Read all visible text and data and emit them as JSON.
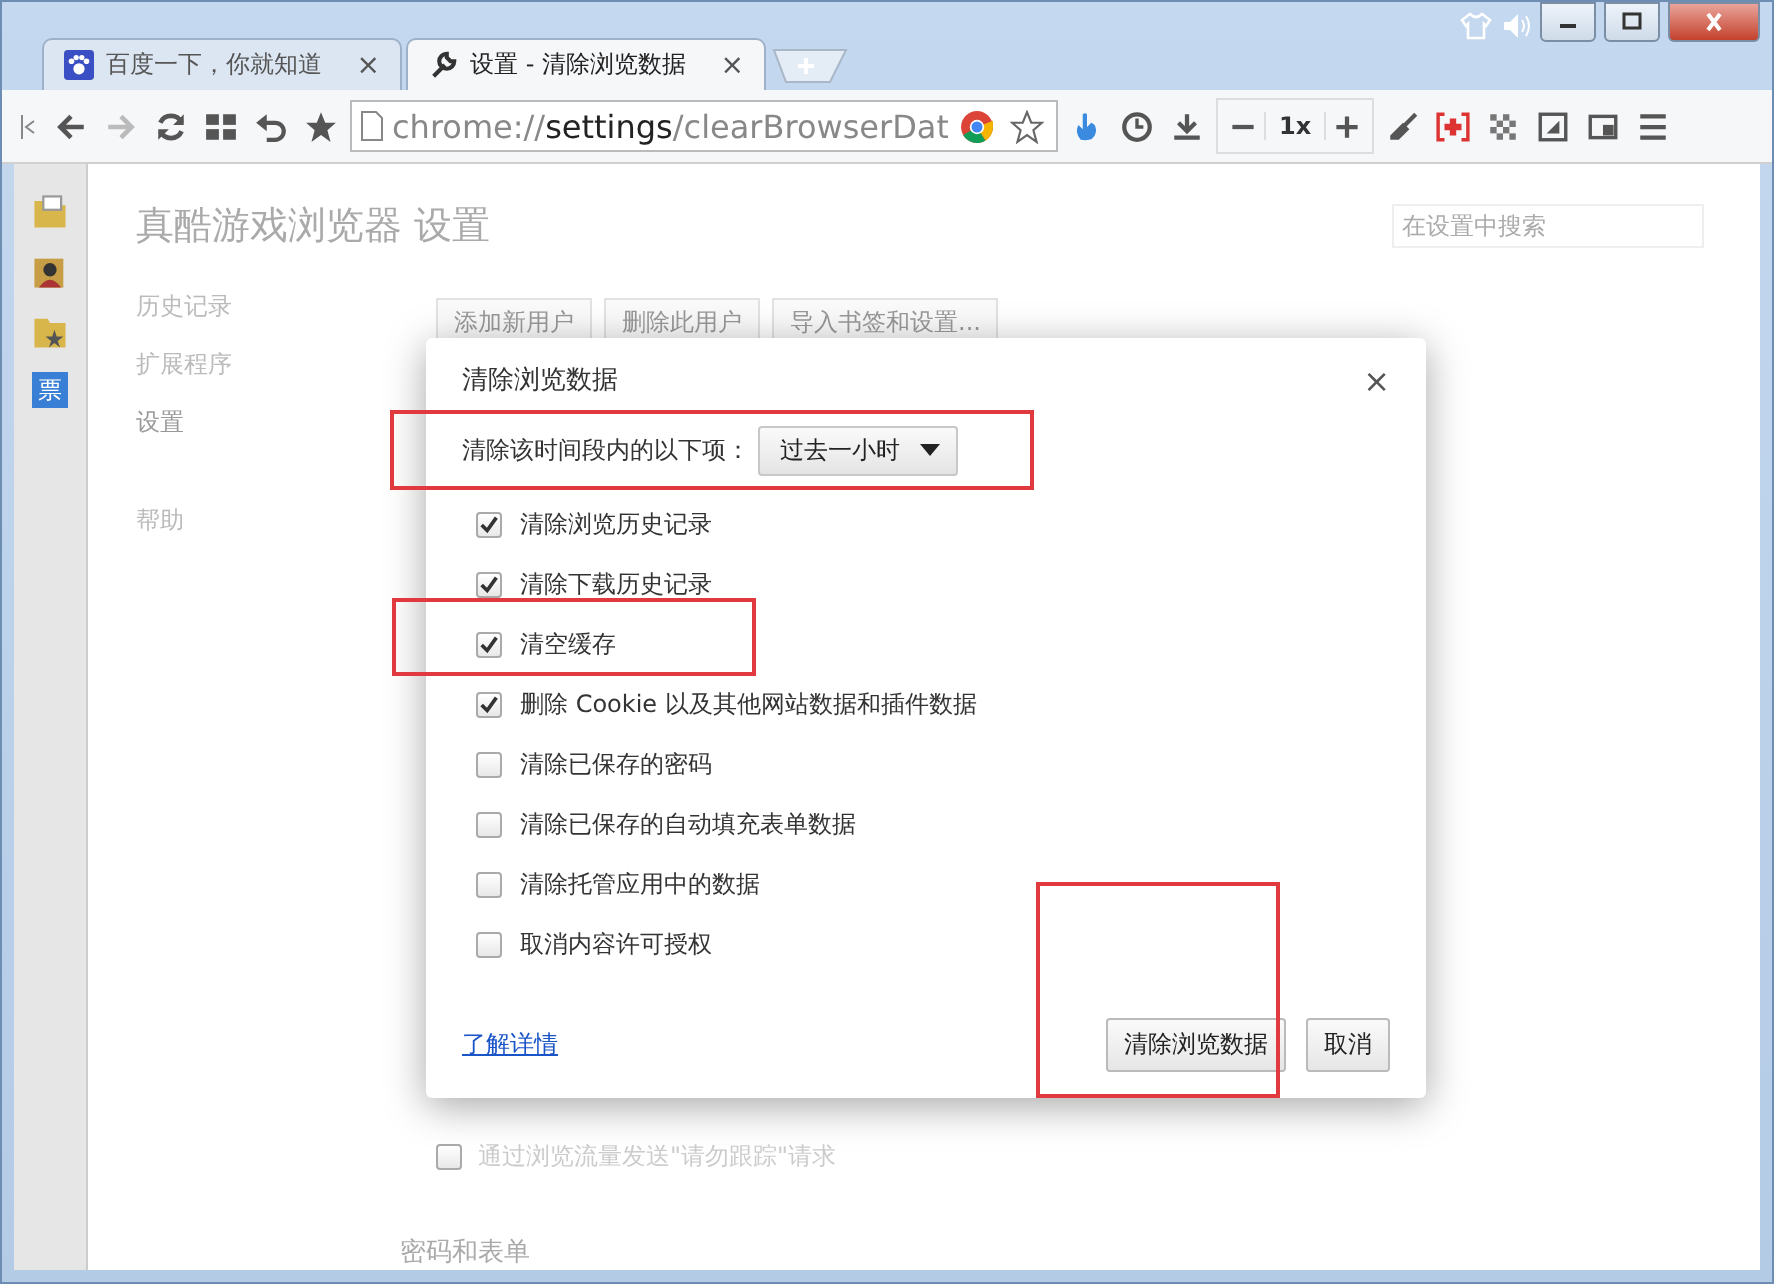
{
  "tabs": [
    {
      "label": "百度一下，你就知道",
      "close": "×",
      "selected": false
    },
    {
      "label": "设置 - 清除浏览数据",
      "close": "×",
      "selected": true
    }
  ],
  "toolbar": {
    "url_scheme": "chrome://",
    "url_host": "settings",
    "url_path": "/clearBrowserDat",
    "zoom": "1x"
  },
  "sidebar": {
    "items": [
      {
        "label": "票",
        "selected": true
      }
    ]
  },
  "settings": {
    "title": "真酷游戏浏览器 设置",
    "search": {
      "placeholder": "在设置中搜索"
    },
    "nav": [
      {
        "label": "历史记录",
        "selected": false
      },
      {
        "label": "扩展程序",
        "selected": false
      },
      {
        "label": "设置",
        "selected": true
      },
      {
        "label": "帮助",
        "selected": false
      }
    ],
    "user_buttons": [
      "添加新用户",
      "删除此用户",
      "导入书签和设置..."
    ],
    "dnt": {
      "label": "通过浏览流量发送\"请勿跟踪\"请求",
      "checked": false
    },
    "section": "密码和表单"
  },
  "dialog": {
    "title": "清除浏览数据",
    "close": "×",
    "range_label": "清除该时间段内的以下项：",
    "range_value": "过去一小时",
    "options": [
      {
        "label": "清除浏览历史记录",
        "checked": true
      },
      {
        "label": "清除下载历史记录",
        "checked": true
      },
      {
        "label": "清空缓存",
        "checked": true
      },
      {
        "label": "删除 Cookie 以及其他网站数据和插件数据",
        "checked": true
      },
      {
        "label": "清除已保存的密码",
        "checked": false
      },
      {
        "label": "清除已保存的自动填充表单数据",
        "checked": false
      },
      {
        "label": "清除托管应用中的数据",
        "checked": false
      },
      {
        "label": "取消内容许可授权",
        "checked": false
      }
    ],
    "link": "了解详情",
    "buttons": [
      "清除浏览数据",
      "取消"
    ]
  }
}
